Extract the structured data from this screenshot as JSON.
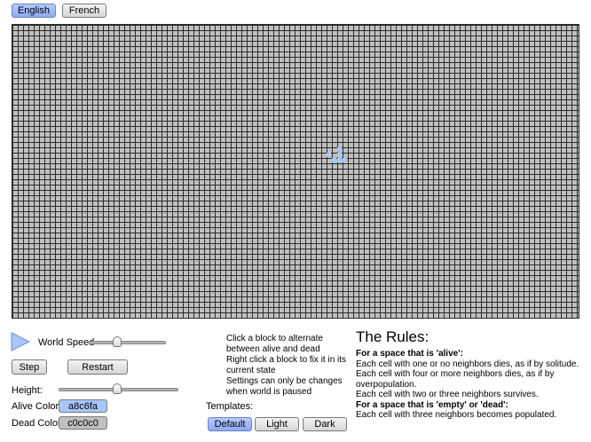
{
  "language": {
    "english_label": "English",
    "french_label": "French",
    "selected": "English"
  },
  "world": {
    "alive_color": "#a8c6fa",
    "dead_color": "#c0c0c0",
    "alive_cells": [
      [
        59,
        24
      ],
      [
        61,
        24
      ],
      [
        61,
        23
      ],
      [
        60,
        25
      ],
      [
        61,
        25
      ],
      [
        62,
        25
      ]
    ]
  },
  "controls": {
    "speed_label": "World Speed",
    "speed_value": 0.35,
    "step_label": "Step",
    "restart_label": "Restart",
    "height_label": "Height:",
    "height_value": 0.49,
    "alive_color_label": "Alive Color:",
    "alive_color_value": "a8c6fa",
    "dead_color_label": "Dead Color:",
    "dead_color_value": "c0c0c0"
  },
  "instructions": [
    "Click a block to alternate between alive and dead",
    "Right click a block to fix it in its current state",
    "Settings can only be changes when world is paused"
  ],
  "templates": {
    "label": "Templates:",
    "options": [
      "Default",
      "Light",
      "Dark"
    ],
    "selected": "Default"
  },
  "rules": {
    "title": "The Rules:",
    "alive_heading": "For a space that is 'alive':",
    "alive_rules": [
      "Each cell with one or no neighbors dies, as if by solitude.",
      "Each cell with four or more neighbors dies, as if by overpopulation.",
      "Each cell with two or three neighbors survives."
    ],
    "dead_heading": "For a space that is 'empty' or 'dead':",
    "dead_rules": [
      "Each cell with three neighbors becomes populated."
    ]
  }
}
